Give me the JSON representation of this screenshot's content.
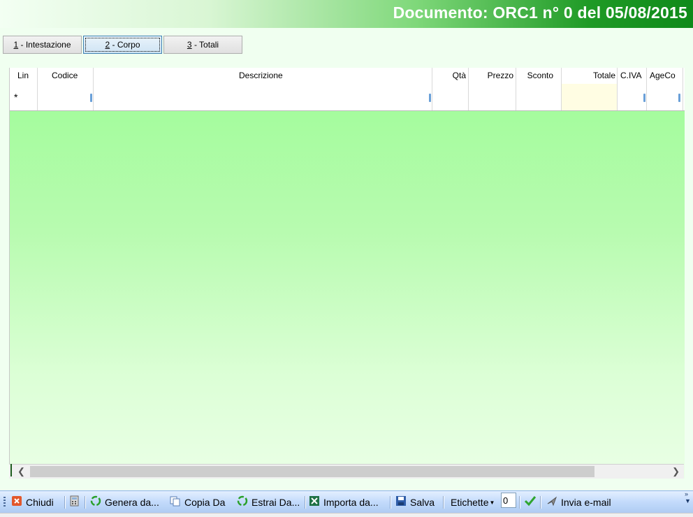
{
  "window": {
    "title": "Documento: ORC1 n° 0 del 05/08/2015"
  },
  "tabs": [
    {
      "hotkey": "1",
      "label": " - Intestazione"
    },
    {
      "hotkey": "2",
      "label": " - Corpo"
    },
    {
      "hotkey": "3",
      "label": " - Totali"
    }
  ],
  "grid": {
    "columns": [
      "Lin",
      "Codice",
      "Descrizione",
      "Qtà",
      "Prezzo",
      "Sconto",
      "Totale",
      "C.IVA",
      "AgeCo"
    ],
    "new_row_marker": "*"
  },
  "toolbar": {
    "chiudi": "Chiudi",
    "genera": "Genera da...",
    "copia": "Copia Da",
    "estrai": "Estrai Da...",
    "importa": "Importa da...",
    "salva": "Salva",
    "etichette": "Etichette",
    "etichette_value": "0",
    "invia": "Invia e-mail"
  },
  "colors": {
    "title_green": "#0f8a1a",
    "grid_green": "#9efc97",
    "total_cell": "#fffde3"
  }
}
